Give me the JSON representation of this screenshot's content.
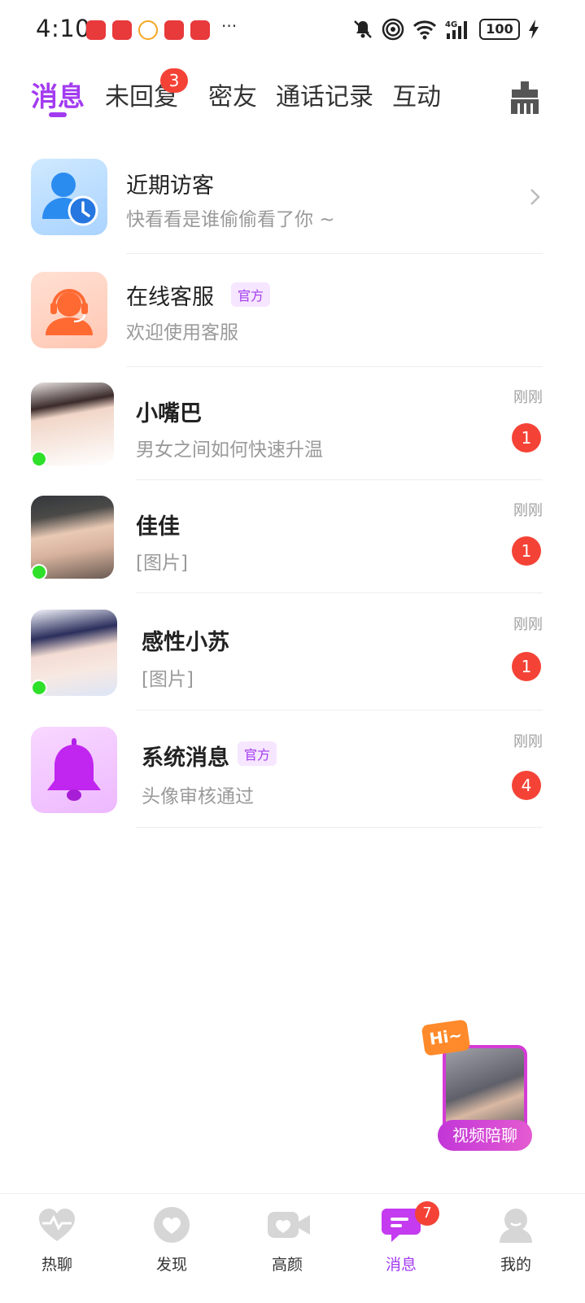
{
  "status_bar": {
    "time": "4:10",
    "more": "···",
    "battery": "100",
    "icons": [
      "notification-app-icon",
      "huawei-app-icon",
      "weibo-app-icon",
      "huawei-app-icon-2",
      "game-app-icon",
      "mute-icon",
      "hotspot-icon",
      "wifi-icon",
      "signal-4g-icon",
      "battery-icon",
      "charging-icon"
    ]
  },
  "tabs": {
    "items": [
      {
        "label": "消息"
      },
      {
        "label": "未回复"
      },
      {
        "label": "密友"
      },
      {
        "label": "通话记录"
      },
      {
        "label": "互动"
      }
    ],
    "unread_badge": "3",
    "active_color": "#a23bf0",
    "clear_icon": "broom-icon"
  },
  "rows": [
    {
      "title": "近期访客",
      "subtitle": "快看看是谁偷偷看了你 ~",
      "icon": "visitor-clock-icon"
    },
    {
      "title": "在线客服",
      "tag": "官方",
      "subtitle": "欢迎使用客服",
      "icon": "headset-service-icon"
    },
    {
      "title": "小嘴巴",
      "subtitle": "男女之间如何快速升温",
      "time": "刚刚",
      "unread": "1",
      "online": true
    },
    {
      "title": "佳佳",
      "subtitle": "[图片]",
      "time": "刚刚",
      "unread": "1",
      "online": true
    },
    {
      "title": "感性小苏",
      "subtitle": "[图片]",
      "time": "刚刚",
      "unread": "1",
      "online": true
    },
    {
      "title": "系统消息",
      "tag": "官方",
      "subtitle": "头像审核通过",
      "time": "刚刚",
      "unread": "4",
      "icon": "bell-icon"
    }
  ],
  "float_widget": {
    "hi": "Hi~",
    "label": "视频陪聊"
  },
  "bottom_nav": {
    "items": [
      {
        "label": "热聊",
        "icon": "heart-pulse-icon"
      },
      {
        "label": "发现",
        "icon": "heart-circle-icon"
      },
      {
        "label": "高颜",
        "icon": "video-heart-icon"
      },
      {
        "label": "消息",
        "icon": "message-icon"
      },
      {
        "label": "我的",
        "icon": "profile-icon"
      }
    ],
    "message_badge": "7",
    "active_color": "#a23bf0",
    "inactive_icon_color": "#d6d6d6"
  }
}
